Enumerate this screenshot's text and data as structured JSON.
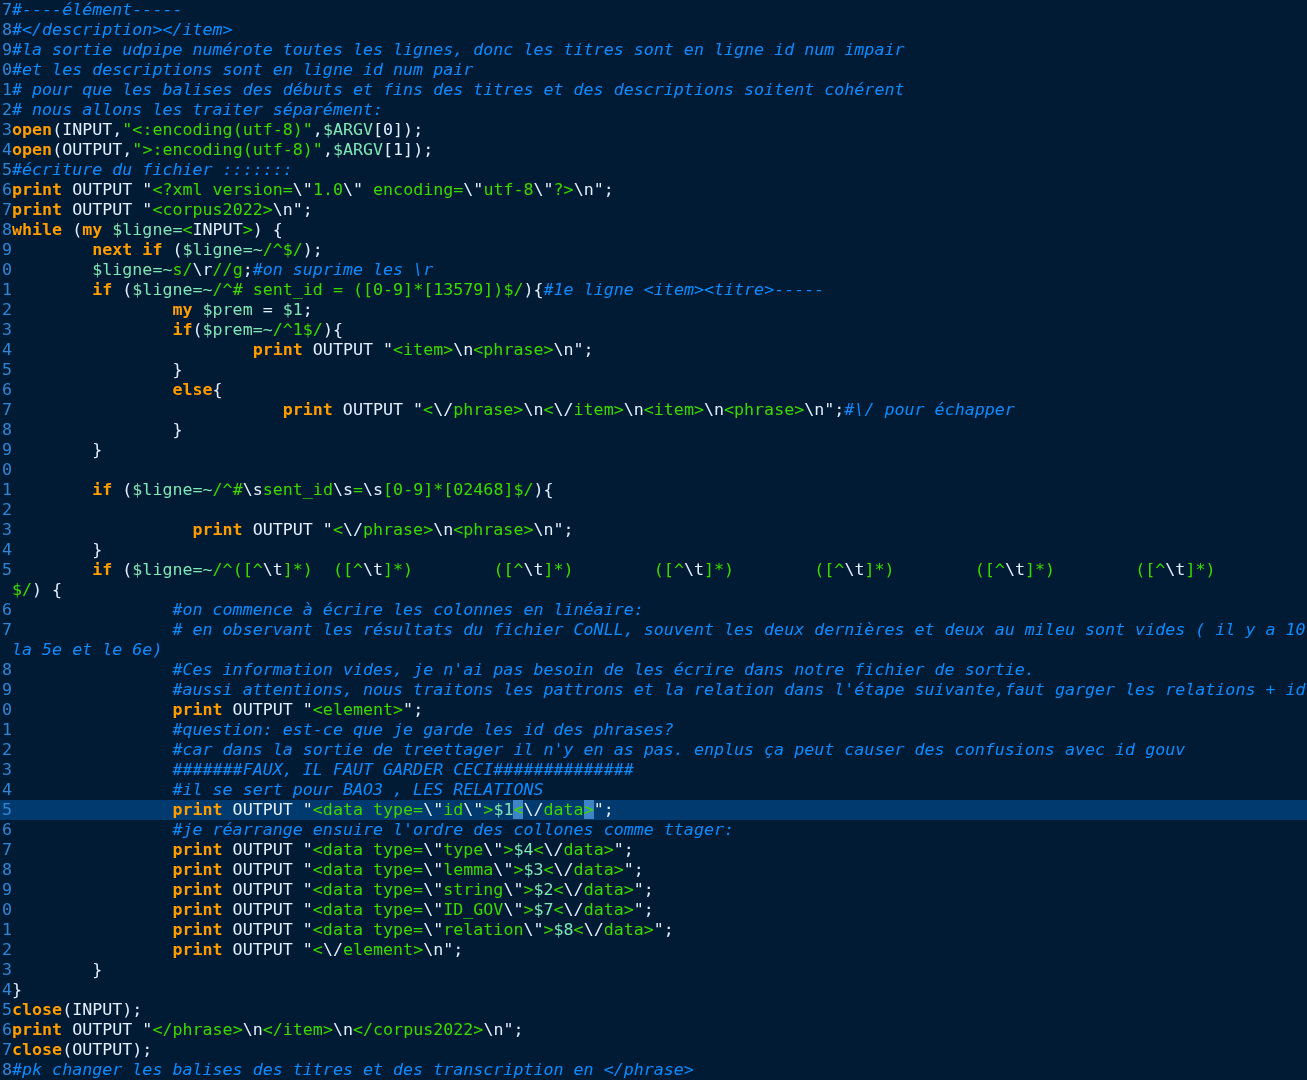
{
  "editor": {
    "lines": [
      {
        "number": "7",
        "current": false,
        "tokens": [
          {
            "kind": "comment",
            "text": "#----élément-----"
          }
        ]
      },
      {
        "number": "8",
        "current": false,
        "tokens": [
          {
            "kind": "comment",
            "text": "#</description></item>"
          }
        ]
      },
      {
        "number": "9",
        "current": false,
        "tokens": [
          {
            "kind": "comment",
            "text": "#la sortie udpipe numérote toutes les lignes, donc les titres sont en ligne id num impair"
          }
        ]
      },
      {
        "number": "0",
        "current": false,
        "tokens": [
          {
            "kind": "comment",
            "text": "#et les descriptions sont en ligne id num pair"
          }
        ]
      },
      {
        "number": "1",
        "current": false,
        "tokens": [
          {
            "kind": "comment",
            "text": "# pour que les balises des débuts et fins des titres et des descriptions soitent cohérent"
          }
        ]
      },
      {
        "number": "2",
        "current": false,
        "tokens": [
          {
            "kind": "comment",
            "text": "# nous allons les traiter séparément:"
          }
        ]
      },
      {
        "number": "3",
        "current": false,
        "tokens": [
          {
            "kind": "keyword",
            "text": "open"
          },
          {
            "kind": "plain",
            "text": "(INPUT,"
          },
          {
            "kind": "string",
            "text": "\"<:encoding(utf-8)\""
          },
          {
            "kind": "plain",
            "text": ","
          },
          {
            "kind": "variable",
            "text": "$ARGV"
          },
          {
            "kind": "plain",
            "text": "[0]);"
          }
        ]
      },
      {
        "number": "4",
        "current": false,
        "tokens": [
          {
            "kind": "keyword",
            "text": "open"
          },
          {
            "kind": "plain",
            "text": "(OUTPUT,"
          },
          {
            "kind": "string",
            "text": "\">:encoding(utf-8)\""
          },
          {
            "kind": "plain",
            "text": ","
          },
          {
            "kind": "variable",
            "text": "$ARGV"
          },
          {
            "kind": "plain",
            "text": "[1]);"
          }
        ]
      },
      {
        "number": "5",
        "current": false,
        "tokens": [
          {
            "kind": "comment",
            "text": "#écriture du fichier :::::::"
          }
        ]
      },
      {
        "number": "6",
        "current": false,
        "tokens": [
          {
            "kind": "keyword",
            "text": "print"
          },
          {
            "kind": "plain",
            "text": " OUTPUT \""
          },
          {
            "kind": "string",
            "text": "<?xml version="
          },
          {
            "kind": "plain",
            "text": "\\\""
          },
          {
            "kind": "string",
            "text": "1.0"
          },
          {
            "kind": "plain",
            "text": "\\\""
          },
          {
            "kind": "string",
            "text": " encoding="
          },
          {
            "kind": "plain",
            "text": "\\\""
          },
          {
            "kind": "string",
            "text": "utf-8"
          },
          {
            "kind": "plain",
            "text": "\\\""
          },
          {
            "kind": "string",
            "text": "?>"
          },
          {
            "kind": "plain",
            "text": "\\n\";"
          }
        ]
      },
      {
        "number": "7",
        "current": false,
        "tokens": [
          {
            "kind": "keyword",
            "text": "print"
          },
          {
            "kind": "plain",
            "text": " OUTPUT \""
          },
          {
            "kind": "string",
            "text": "<corpus2022>"
          },
          {
            "kind": "plain",
            "text": "\\n\";"
          }
        ]
      },
      {
        "number": "8",
        "current": false,
        "tokens": [
          {
            "kind": "keyword",
            "text": "while"
          },
          {
            "kind": "plain",
            "text": " ("
          },
          {
            "kind": "keyword",
            "text": "my"
          },
          {
            "kind": "space"
          },
          {
            "kind": "variable",
            "text": "$ligne="
          },
          {
            "kind": "string",
            "text": "<"
          },
          {
            "kind": "plain",
            "text": "INPUT"
          },
          {
            "kind": "string",
            "text": ">"
          },
          {
            "kind": "plain",
            "text": ") {"
          }
        ]
      },
      {
        "number": "9",
        "current": false,
        "tokens": [
          {
            "kind": "tab"
          },
          {
            "kind": "keyword",
            "text": "next if"
          },
          {
            "kind": "plain",
            "text": " ("
          },
          {
            "kind": "variable",
            "text": "$ligne=~"
          },
          {
            "kind": "string",
            "text": "/^$/"
          },
          {
            "kind": "plain",
            "text": ");"
          }
        ]
      },
      {
        "number": "0",
        "current": false,
        "tokens": [
          {
            "kind": "tab"
          },
          {
            "kind": "variable",
            "text": "$ligne=~"
          },
          {
            "kind": "string",
            "text": "s/"
          },
          {
            "kind": "plain",
            "text": "\\r"
          },
          {
            "kind": "string",
            "text": "//g"
          },
          {
            "kind": "plain",
            "text": ";"
          },
          {
            "kind": "comment",
            "text": "#on suprime les \\r"
          }
        ]
      },
      {
        "number": "1",
        "current": false,
        "tokens": [
          {
            "kind": "tab"
          },
          {
            "kind": "keyword",
            "text": "if"
          },
          {
            "kind": "plain",
            "text": " ("
          },
          {
            "kind": "variable",
            "text": "$ligne=~"
          },
          {
            "kind": "string",
            "text": "/^# sent_id = ([0-9]*[13579])$/"
          },
          {
            "kind": "plain",
            "text": "){"
          },
          {
            "kind": "comment",
            "text": "#1e ligne <item><titre>-----"
          }
        ]
      },
      {
        "number": "2",
        "current": false,
        "tokens": [
          {
            "kind": "tab"
          },
          {
            "kind": "tab"
          },
          {
            "kind": "keyword",
            "text": "my"
          },
          {
            "kind": "space"
          },
          {
            "kind": "variable",
            "text": "$prem"
          },
          {
            "kind": "plain",
            "text": " = "
          },
          {
            "kind": "variable",
            "text": "$1"
          },
          {
            "kind": "plain",
            "text": ";"
          }
        ]
      },
      {
        "number": "3",
        "current": false,
        "tokens": [
          {
            "kind": "tab"
          },
          {
            "kind": "tab"
          },
          {
            "kind": "keyword",
            "text": "if"
          },
          {
            "kind": "plain",
            "text": "("
          },
          {
            "kind": "variable",
            "text": "$prem=~"
          },
          {
            "kind": "string",
            "text": "/^1$/"
          },
          {
            "kind": "plain",
            "text": "){"
          }
        ]
      },
      {
        "number": "4",
        "current": false,
        "tokens": [
          {
            "kind": "tab"
          },
          {
            "kind": "tab"
          },
          {
            "kind": "tab"
          },
          {
            "kind": "keyword",
            "text": "print"
          },
          {
            "kind": "plain",
            "text": " OUTPUT \""
          },
          {
            "kind": "string",
            "text": "<item>"
          },
          {
            "kind": "plain",
            "text": "\\n"
          },
          {
            "kind": "string",
            "text": "<phrase>"
          },
          {
            "kind": "plain",
            "text": "\\n\";"
          }
        ]
      },
      {
        "number": "5",
        "current": false,
        "tokens": [
          {
            "kind": "tab"
          },
          {
            "kind": "tab"
          },
          {
            "kind": "plain",
            "text": "}"
          }
        ]
      },
      {
        "number": "6",
        "current": false,
        "tokens": [
          {
            "kind": "tab"
          },
          {
            "kind": "tab"
          },
          {
            "kind": "keyword",
            "text": "else"
          },
          {
            "kind": "plain",
            "text": "{"
          }
        ]
      },
      {
        "number": "7",
        "current": false,
        "tokens": [
          {
            "kind": "tab"
          },
          {
            "kind": "tab"
          },
          {
            "kind": "tab"
          },
          {
            "kind": "space"
          },
          {
            "kind": "space"
          },
          {
            "kind": "space"
          },
          {
            "kind": "keyword",
            "text": "print"
          },
          {
            "kind": "plain",
            "text": " OUTPUT \""
          },
          {
            "kind": "string",
            "text": "<"
          },
          {
            "kind": "plain",
            "text": "\\/"
          },
          {
            "kind": "string",
            "text": "phrase>"
          },
          {
            "kind": "plain",
            "text": "\\n"
          },
          {
            "kind": "string",
            "text": "<"
          },
          {
            "kind": "plain",
            "text": "\\/"
          },
          {
            "kind": "string",
            "text": "item>"
          },
          {
            "kind": "plain",
            "text": "\\n"
          },
          {
            "kind": "string",
            "text": "<item>"
          },
          {
            "kind": "plain",
            "text": "\\n"
          },
          {
            "kind": "string",
            "text": "<phrase>"
          },
          {
            "kind": "plain",
            "text": "\\n\";"
          },
          {
            "kind": "comment",
            "text": "#\\/ pour échapper"
          }
        ]
      },
      {
        "number": "8",
        "current": false,
        "tokens": [
          {
            "kind": "tab"
          },
          {
            "kind": "tab"
          },
          {
            "kind": "plain",
            "text": "}"
          }
        ]
      },
      {
        "number": "9",
        "current": false,
        "tokens": [
          {
            "kind": "tab"
          },
          {
            "kind": "plain",
            "text": "}"
          }
        ]
      },
      {
        "number": "0",
        "current": false
      },
      {
        "number": "1",
        "current": false,
        "tokens": [
          {
            "kind": "tab"
          },
          {
            "kind": "keyword",
            "text": "if"
          },
          {
            "kind": "plain",
            "text": " ("
          },
          {
            "kind": "variable",
            "text": "$ligne=~"
          },
          {
            "kind": "string",
            "text": "/^#"
          },
          {
            "kind": "plain",
            "text": "\\s"
          },
          {
            "kind": "string",
            "text": "sent_id"
          },
          {
            "kind": "plain",
            "text": "\\s"
          },
          {
            "kind": "string",
            "text": "="
          },
          {
            "kind": "plain",
            "text": "\\s"
          },
          {
            "kind": "string",
            "text": "[0-9]*[02468]$/"
          },
          {
            "kind": "plain",
            "text": "){"
          }
        ]
      },
      {
        "number": "2",
        "current": false
      },
      {
        "number": "3",
        "current": false,
        "tokens": [
          {
            "kind": "tab"
          },
          {
            "kind": "tab"
          },
          {
            "kind": "space"
          },
          {
            "kind": "space"
          },
          {
            "kind": "keyword",
            "text": "print"
          },
          {
            "kind": "plain",
            "text": " OUTPUT \""
          },
          {
            "kind": "string",
            "text": "<"
          },
          {
            "kind": "plain",
            "text": "\\/"
          },
          {
            "kind": "string",
            "text": "phrase>"
          },
          {
            "kind": "plain",
            "text": "\\n"
          },
          {
            "kind": "string",
            "text": "<phrase>"
          },
          {
            "kind": "plain",
            "text": "\\n\";"
          }
        ]
      },
      {
        "number": "4",
        "current": false,
        "tokens": [
          {
            "kind": "tab"
          },
          {
            "kind": "plain",
            "text": "}"
          }
        ]
      },
      {
        "number": "5",
        "current": false,
        "tokens": [
          {
            "kind": "tab"
          },
          {
            "kind": "keyword",
            "text": "if"
          },
          {
            "kind": "plain",
            "text": " ("
          },
          {
            "kind": "variable",
            "text": "$ligne=~"
          },
          {
            "kind": "string",
            "text": "/^([^"
          },
          {
            "kind": "plain",
            "text": "\\t"
          },
          {
            "kind": "string",
            "text": "]*)"
          },
          {
            "kind": "space"
          },
          {
            "kind": "space"
          },
          {
            "kind": "string",
            "text": "([^"
          },
          {
            "kind": "plain",
            "text": "\\t"
          },
          {
            "kind": "string",
            "text": "]*)"
          },
          {
            "kind": "tab"
          },
          {
            "kind": "string",
            "text": "([^"
          },
          {
            "kind": "plain",
            "text": "\\t"
          },
          {
            "kind": "string",
            "text": "]*)"
          },
          {
            "kind": "tab"
          },
          {
            "kind": "string",
            "text": "([^"
          },
          {
            "kind": "plain",
            "text": "\\t"
          },
          {
            "kind": "string",
            "text": "]*)"
          },
          {
            "kind": "tab"
          },
          {
            "kind": "string",
            "text": "([^"
          },
          {
            "kind": "plain",
            "text": "\\t"
          },
          {
            "kind": "string",
            "text": "]*)"
          },
          {
            "kind": "tab"
          },
          {
            "kind": "string",
            "text": "([^"
          },
          {
            "kind": "plain",
            "text": "\\t"
          },
          {
            "kind": "string",
            "text": "]*)"
          },
          {
            "kind": "tab"
          },
          {
            "kind": "string",
            "text": "([^"
          },
          {
            "kind": "plain",
            "text": "\\t"
          },
          {
            "kind": "string",
            "text": "]*)"
          }
        ]
      },
      {
        "current": false,
        "tokens": [
          {
            "kind": "string",
            "text": "$/"
          },
          {
            "kind": "plain",
            "text": ") {"
          }
        ]
      },
      {
        "number": "6",
        "current": false,
        "tokens": [
          {
            "kind": "tab"
          },
          {
            "kind": "tab"
          },
          {
            "kind": "comment",
            "text": "#on commence à écrire les colonnes en linéaire:"
          }
        ]
      },
      {
        "number": "7",
        "current": false,
        "tokens": [
          {
            "kind": "tab"
          },
          {
            "kind": "tab"
          },
          {
            "kind": "comment",
            "text": "# en observant les résultats du fichier CoNLL, souvent les deux dernières et deux au mileu sont vides ( il y a 10"
          }
        ]
      },
      {
        "current": false,
        "tokens": [
          {
            "kind": "comment",
            "text": "la 5e et le 6e)"
          }
        ]
      },
      {
        "number": "8",
        "current": false,
        "tokens": [
          {
            "kind": "tab"
          },
          {
            "kind": "tab"
          },
          {
            "kind": "comment",
            "text": "#Ces information vides, je n'ai pas besoin de les écrire dans notre fichier de sortie."
          }
        ]
      },
      {
        "number": "9",
        "current": false,
        "tokens": [
          {
            "kind": "tab"
          },
          {
            "kind": "tab"
          },
          {
            "kind": "comment",
            "text": "#aussi attentions, nous traitons les pattrons et la relation dans l'étape suivante,faut garger les relations + id"
          }
        ]
      },
      {
        "number": "0",
        "current": false,
        "tokens": [
          {
            "kind": "tab"
          },
          {
            "kind": "tab"
          },
          {
            "kind": "keyword",
            "text": "print"
          },
          {
            "kind": "plain",
            "text": " OUTPUT \""
          },
          {
            "kind": "string",
            "text": "<element>"
          },
          {
            "kind": "plain",
            "text": "\";"
          }
        ]
      },
      {
        "number": "1",
        "current": false,
        "tokens": [
          {
            "kind": "tab"
          },
          {
            "kind": "tab"
          },
          {
            "kind": "comment",
            "text": "#question: est-ce que je garde les id des phrases?"
          }
        ]
      },
      {
        "number": "2",
        "current": false,
        "tokens": [
          {
            "kind": "tab"
          },
          {
            "kind": "tab"
          },
          {
            "kind": "comment",
            "text": "#car dans la sortie de treettager il n'y en as pas. enplus ça peut causer des confusions avec id gouv"
          }
        ]
      },
      {
        "number": "3",
        "current": false,
        "tokens": [
          {
            "kind": "tab"
          },
          {
            "kind": "tab"
          },
          {
            "kind": "comment",
            "text": "#######FAUX, IL FAUT GARDER CECI##############"
          }
        ]
      },
      {
        "number": "4",
        "current": false,
        "tokens": [
          {
            "kind": "tab"
          },
          {
            "kind": "tab"
          },
          {
            "kind": "comment",
            "text": "#il se sert pour BAO3 , LES RELATIONS"
          }
        ]
      },
      {
        "number": "5",
        "current": true,
        "tokens": [
          {
            "kind": "tab"
          },
          {
            "kind": "tab"
          },
          {
            "kind": "keyword",
            "text": "print"
          },
          {
            "kind": "plain",
            "text": " OUTPUT \""
          },
          {
            "kind": "string",
            "text": "<data type="
          },
          {
            "kind": "plain",
            "text": "\\\""
          },
          {
            "kind": "string",
            "text": "id"
          },
          {
            "kind": "plain",
            "text": "\\\""
          },
          {
            "kind": "string",
            "text": ">"
          },
          {
            "kind": "variable",
            "text": "$1"
          },
          {
            "kind": "match",
            "text": "<"
          },
          {
            "kind": "plain",
            "text": "\\/"
          },
          {
            "kind": "string",
            "text": "data"
          },
          {
            "kind": "match",
            "text": ">"
          },
          {
            "kind": "plain",
            "text": "\";"
          }
        ]
      },
      {
        "number": "6",
        "current": false,
        "tokens": [
          {
            "kind": "tab"
          },
          {
            "kind": "tab"
          },
          {
            "kind": "comment",
            "text": "#je réarrange ensuire l'ordre des collones comme ttager:"
          }
        ]
      },
      {
        "number": "7",
        "current": false,
        "tokens": [
          {
            "kind": "tab"
          },
          {
            "kind": "tab"
          },
          {
            "kind": "keyword",
            "text": "print"
          },
          {
            "kind": "plain",
            "text": " OUTPUT \""
          },
          {
            "kind": "string",
            "text": "<data type="
          },
          {
            "kind": "plain",
            "text": "\\\""
          },
          {
            "kind": "string",
            "text": "type"
          },
          {
            "kind": "plain",
            "text": "\\\""
          },
          {
            "kind": "string",
            "text": ">"
          },
          {
            "kind": "variable",
            "text": "$4"
          },
          {
            "kind": "string",
            "text": "<"
          },
          {
            "kind": "plain",
            "text": "\\/"
          },
          {
            "kind": "string",
            "text": "data>"
          },
          {
            "kind": "plain",
            "text": "\";"
          }
        ]
      },
      {
        "number": "8",
        "current": false,
        "tokens": [
          {
            "kind": "tab"
          },
          {
            "kind": "tab"
          },
          {
            "kind": "keyword",
            "text": "print"
          },
          {
            "kind": "plain",
            "text": " OUTPUT \""
          },
          {
            "kind": "string",
            "text": "<data type="
          },
          {
            "kind": "plain",
            "text": "\\\""
          },
          {
            "kind": "string",
            "text": "lemma"
          },
          {
            "kind": "plain",
            "text": "\\\""
          },
          {
            "kind": "string",
            "text": ">"
          },
          {
            "kind": "variable",
            "text": "$3"
          },
          {
            "kind": "string",
            "text": "<"
          },
          {
            "kind": "plain",
            "text": "\\/"
          },
          {
            "kind": "string",
            "text": "data>"
          },
          {
            "kind": "plain",
            "text": "\";"
          }
        ]
      },
      {
        "number": "9",
        "current": false,
        "tokens": [
          {
            "kind": "tab"
          },
          {
            "kind": "tab"
          },
          {
            "kind": "keyword",
            "text": "print"
          },
          {
            "kind": "plain",
            "text": " OUTPUT \""
          },
          {
            "kind": "string",
            "text": "<data type="
          },
          {
            "kind": "plain",
            "text": "\\\""
          },
          {
            "kind": "string",
            "text": "string"
          },
          {
            "kind": "plain",
            "text": "\\\""
          },
          {
            "kind": "string",
            "text": ">"
          },
          {
            "kind": "variable",
            "text": "$2"
          },
          {
            "kind": "string",
            "text": "<"
          },
          {
            "kind": "plain",
            "text": "\\/"
          },
          {
            "kind": "string",
            "text": "data>"
          },
          {
            "kind": "plain",
            "text": "\";"
          }
        ]
      },
      {
        "number": "0",
        "current": false,
        "tokens": [
          {
            "kind": "tab"
          },
          {
            "kind": "tab"
          },
          {
            "kind": "keyword",
            "text": "print"
          },
          {
            "kind": "plain",
            "text": " OUTPUT \""
          },
          {
            "kind": "string",
            "text": "<data type="
          },
          {
            "kind": "plain",
            "text": "\\\""
          },
          {
            "kind": "string",
            "text": "ID_GOV"
          },
          {
            "kind": "plain",
            "text": "\\\""
          },
          {
            "kind": "string",
            "text": ">"
          },
          {
            "kind": "variable",
            "text": "$7"
          },
          {
            "kind": "string",
            "text": "<"
          },
          {
            "kind": "plain",
            "text": "\\/"
          },
          {
            "kind": "string",
            "text": "data>"
          },
          {
            "kind": "plain",
            "text": "\";"
          }
        ]
      },
      {
        "number": "1",
        "current": false,
        "tokens": [
          {
            "kind": "tab"
          },
          {
            "kind": "tab"
          },
          {
            "kind": "keyword",
            "text": "print"
          },
          {
            "kind": "plain",
            "text": " OUTPUT \""
          },
          {
            "kind": "string",
            "text": "<data type="
          },
          {
            "kind": "plain",
            "text": "\\\""
          },
          {
            "kind": "string",
            "text": "relation"
          },
          {
            "kind": "plain",
            "text": "\\\""
          },
          {
            "kind": "string",
            "text": ">"
          },
          {
            "kind": "variable",
            "text": "$8"
          },
          {
            "kind": "string",
            "text": "<"
          },
          {
            "kind": "plain",
            "text": "\\/"
          },
          {
            "kind": "string",
            "text": "data>"
          },
          {
            "kind": "plain",
            "text": "\";"
          }
        ]
      },
      {
        "number": "2",
        "current": false,
        "tokens": [
          {
            "kind": "tab"
          },
          {
            "kind": "tab"
          },
          {
            "kind": "keyword",
            "text": "print"
          },
          {
            "kind": "plain",
            "text": " OUTPUT \""
          },
          {
            "kind": "string",
            "text": "<"
          },
          {
            "kind": "plain",
            "text": "\\/"
          },
          {
            "kind": "string",
            "text": "element>"
          },
          {
            "kind": "plain",
            "text": "\\n\";"
          }
        ]
      },
      {
        "number": "3",
        "current": false,
        "tokens": [
          {
            "kind": "tab"
          },
          {
            "kind": "plain",
            "text": "}"
          }
        ]
      },
      {
        "number": "4",
        "current": false,
        "tokens": [
          {
            "kind": "plain",
            "text": "}"
          }
        ]
      },
      {
        "number": "5",
        "current": false,
        "tokens": [
          {
            "kind": "keyword",
            "text": "close"
          },
          {
            "kind": "plain",
            "text": "(INPUT);"
          }
        ]
      },
      {
        "number": "6",
        "current": false,
        "tokens": [
          {
            "kind": "keyword",
            "text": "print"
          },
          {
            "kind": "plain",
            "text": " OUTPUT \""
          },
          {
            "kind": "string",
            "text": "</phrase>"
          },
          {
            "kind": "plain",
            "text": "\\n"
          },
          {
            "kind": "string",
            "text": "</item>"
          },
          {
            "kind": "plain",
            "text": "\\n"
          },
          {
            "kind": "string",
            "text": "</corpus2022>"
          },
          {
            "kind": "plain",
            "text": "\\n\";"
          }
        ]
      },
      {
        "number": "7",
        "current": false,
        "tokens": [
          {
            "kind": "keyword",
            "text": "close"
          },
          {
            "kind": "plain",
            "text": "(OUTPUT);"
          }
        ]
      },
      {
        "number": "8",
        "current": false,
        "tokens": [
          {
            "kind": "comment",
            "text": "#pk changer les balises des titres et des transcription en </phrase>"
          }
        ]
      }
    ]
  }
}
